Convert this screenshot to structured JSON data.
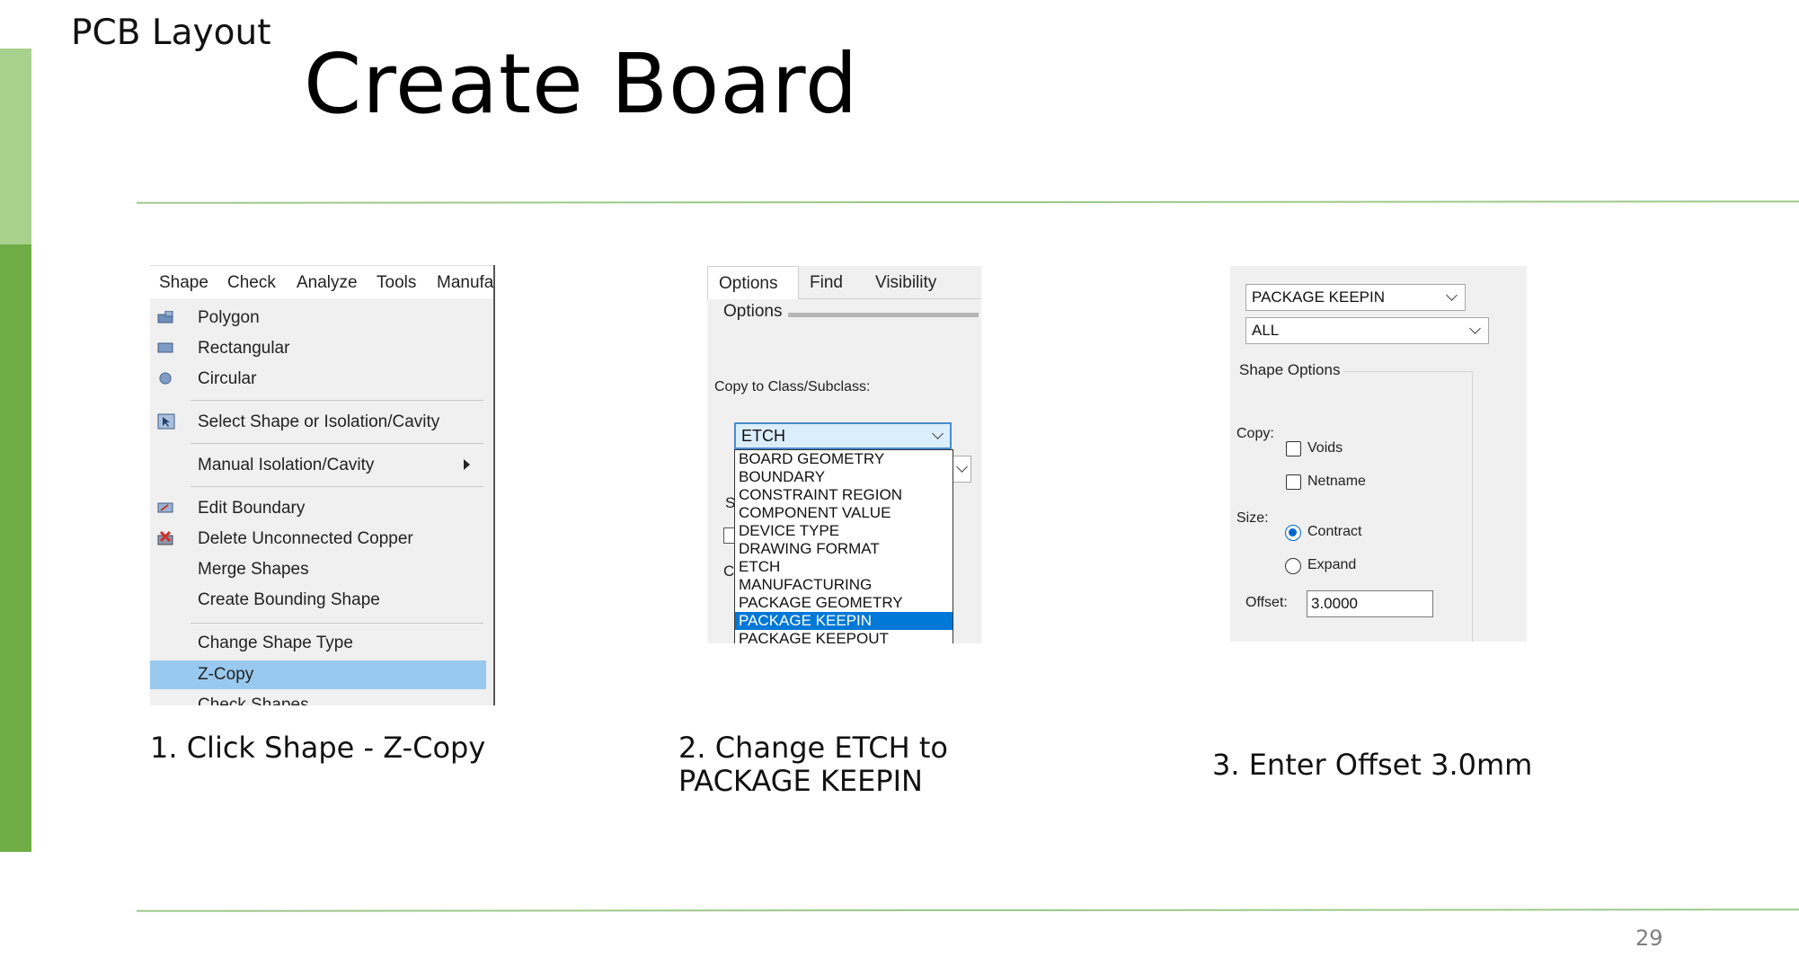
{
  "slide": {
    "section_label": "PCB Layout",
    "title": "Create Board",
    "page_number": "29",
    "colors": {
      "accent_light": "#a9d18e",
      "accent_dark": "#70ad47",
      "rule": "#9dc88a"
    }
  },
  "step1": {
    "caption": "1. Click Shape - Z-Copy",
    "menubar": [
      "Shape",
      "Check",
      "Analyze",
      "Tools",
      "Manufa"
    ],
    "menu_items": [
      {
        "label": "Polygon",
        "icon": "polygon-icon"
      },
      {
        "label": "Rectangular",
        "icon": "rectangle-icon"
      },
      {
        "label": "Circular",
        "icon": "circle-icon"
      },
      {
        "label": "Select Shape or Isolation/Cavity",
        "icon": "select-shape-icon"
      },
      {
        "label": "Manual Isolation/Cavity",
        "icon": "submenu-arrow-icon"
      },
      {
        "label": "Edit Boundary",
        "icon": "edit-boundary-icon"
      },
      {
        "label": "Delete Unconnected Copper",
        "icon": "delete-copper-icon"
      },
      {
        "label": "Merge Shapes",
        "icon": ""
      },
      {
        "label": "Create Bounding Shape",
        "icon": ""
      },
      {
        "label": "Change Shape Type",
        "icon": ""
      },
      {
        "label": "Z-Copy",
        "icon": "",
        "selected": true
      },
      {
        "label": "Check Shapes",
        "icon": ""
      }
    ]
  },
  "step2": {
    "caption_line1": "2. Change ETCH to",
    "caption_line2": "PACKAGE KEEPIN",
    "tabs": [
      "Options",
      "Find",
      "Visibility"
    ],
    "options_label": "Options",
    "copy_to_label": "Copy to Class/Subclass:",
    "class_value": "ETCH",
    "class_options": [
      "BOARD GEOMETRY",
      "BOUNDARY",
      "CONSTRAINT REGION",
      "COMPONENT VALUE",
      "DEVICE TYPE",
      "DRAWING FORMAT",
      "ETCH",
      "MANUFACTURING",
      "PACKAGE GEOMETRY",
      "PACKAGE KEEPIN",
      "PACKAGE KEEPOUT"
    ],
    "highlighted_option": "PACKAGE KEEPIN"
  },
  "step3": {
    "caption": "3. Enter Offset 3.0mm",
    "class_value": "PACKAGE KEEPIN",
    "subclass_value": "ALL",
    "group_label": "Shape Options",
    "copy_label": "Copy:",
    "voids_label": "Voids",
    "netname_label": "Netname",
    "size_label": "Size:",
    "contract_label": "Contract",
    "expand_label": "Expand",
    "offset_label": "Offset:",
    "offset_value": "3.0000",
    "voids_checked": false,
    "netname_checked": false,
    "size_selected": "Contract"
  }
}
